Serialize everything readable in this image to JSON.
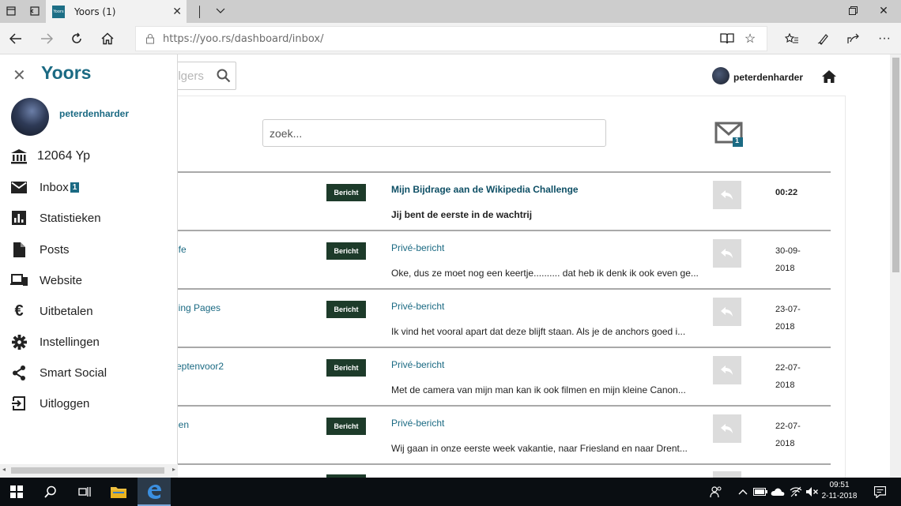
{
  "browser": {
    "tab_title": "Yoors (1)",
    "favicon_text": "Yoors",
    "url": "https://yoo.rs/dashboard/inbox/"
  },
  "header": {
    "search_placeholder": "olgers",
    "username": "peterdenharder"
  },
  "inbox": {
    "search_placeholder": "zoek...",
    "mail_badge_count": "1",
    "messages": [
      {
        "from": "",
        "badge": "Bericht",
        "subject": "Mijn Bijdrage aan de Wikipedia Challenge",
        "preview": "Jij bent de eerste in de wachtrij",
        "date": "00:22",
        "unread": true
      },
      {
        "from": "lfe",
        "badge": "Bericht",
        "subject": "Privé-bericht",
        "preview": "Oke, dus ze moet nog een keertje.......... dat heb ik denk ik ook even ge...",
        "date_line1": "30-09-",
        "date_line2": "2018",
        "unread": false
      },
      {
        "from": "ling Pages",
        "badge": "Bericht",
        "subject": "Privé-bericht",
        "preview": "Ik vind het vooral apart dat deze blijft staan. Als je de anchors goed i...",
        "date_line1": "23-07-",
        "date_line2": "2018",
        "unread": false
      },
      {
        "from": "eptenvoor2",
        "badge": "Bericht",
        "subject": "Privé-bericht",
        "preview": "Met de camera van mijn man kan ik ook filmen en mijn kleine Canon...",
        "date_line1": "22-07-",
        "date_line2": "2018",
        "unread": false
      },
      {
        "from": "ien",
        "badge": "Bericht",
        "subject": "Privé-bericht",
        "preview": "Wij gaan in onze eerste week vakantie, naar Friesland en naar Drent...",
        "date_line1": "22-07-",
        "date_line2": "2018",
        "unread": false
      }
    ]
  },
  "drawer": {
    "brand": "Yoors",
    "username": "peterdenharder",
    "balance": "12064 Yp",
    "inbox_label": "Inbox",
    "inbox_count": "1",
    "items": [
      {
        "label": "Statistieken",
        "icon": "bar-chart-icon"
      },
      {
        "label": "Posts",
        "icon": "document-icon"
      },
      {
        "label": "Website",
        "icon": "devices-icon"
      },
      {
        "label": "Uitbetalen",
        "icon": "euro-icon"
      },
      {
        "label": "Instellingen",
        "icon": "gear-icon"
      },
      {
        "label": "Smart Social",
        "icon": "share-icon"
      },
      {
        "label": "Uitloggen",
        "icon": "logout-icon"
      }
    ]
  },
  "taskbar": {
    "time": "09:51",
    "date": "2-11-2018"
  },
  "colors": {
    "brand": "#1b6a83",
    "badge_bg": "#1d3b2a",
    "taskbar": "#0a0e12"
  }
}
